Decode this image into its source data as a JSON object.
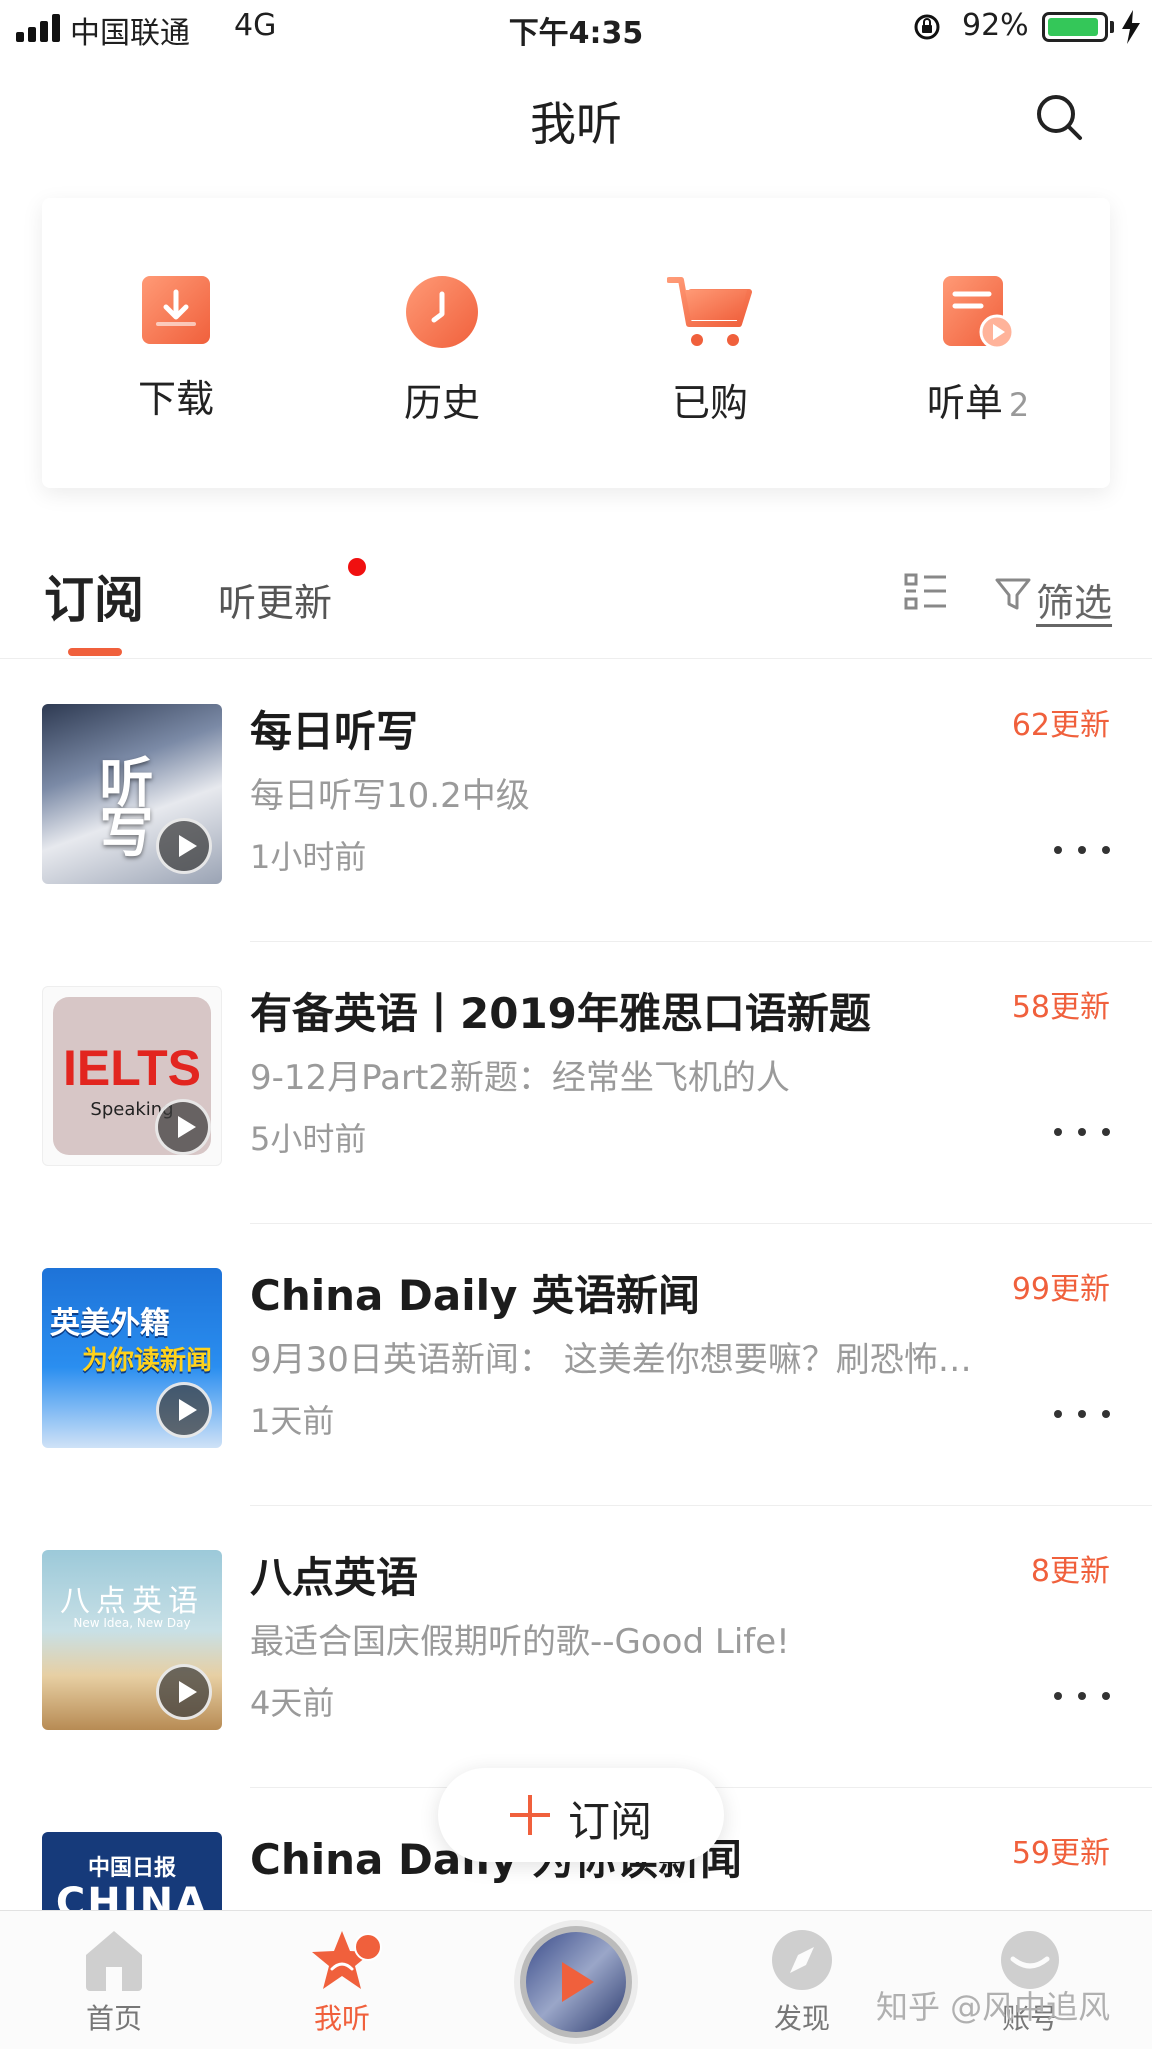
{
  "status_bar": {
    "carrier": "中国联通",
    "network": "4G",
    "time": "下午4:35",
    "battery_percent": "92%",
    "battery_level": 0.92
  },
  "header": {
    "title": "我听",
    "search_icon": "search-icon"
  },
  "quick_actions": [
    {
      "label": "下载",
      "icon": "download-icon",
      "count": ""
    },
    {
      "label": "历史",
      "icon": "clock-icon",
      "count": ""
    },
    {
      "label": "已购",
      "icon": "cart-icon",
      "count": ""
    },
    {
      "label": "听单",
      "icon": "playlist-icon",
      "count": "2"
    }
  ],
  "tabs": {
    "subscribe": "订阅",
    "updates": "听更新",
    "filter": "筛选"
  },
  "subscriptions": [
    {
      "title": "每日听写",
      "subtitle": "每日听写10.2中级",
      "time": "1小时前",
      "badge": "62更新",
      "cover_text": "听写"
    },
    {
      "title": "有备英语丨2019年雅思口语新题",
      "subtitle": "9-12月Part2新题：经常坐飞机的人",
      "time": "5小时前",
      "badge": "58更新",
      "cover_text": "IELTS",
      "cover_sub": "Speaking"
    },
    {
      "title": "China Daily 英语新闻",
      "subtitle": "9月30日英语新闻：  这美差你想要嘛？刷恐怖…",
      "time": "1天前",
      "badge": "99更新",
      "cover_text": "英美外籍",
      "cover_sub": "为你读新闻"
    },
    {
      "title": "八点英语",
      "subtitle": "最适合国庆假期听的歌--Good Life!",
      "time": "4天前",
      "badge": "8更新",
      "cover_text": "八点英语",
      "cover_sub": "New Idea, New Day"
    },
    {
      "title": "China Daily 为你读新闻",
      "subtitle": "",
      "time": "",
      "badge": "59更新",
      "cover_text": "中国日报",
      "cover_sub": "CHINA"
    }
  ],
  "fab": {
    "label": "订阅"
  },
  "bottom_nav": [
    {
      "label": "首页",
      "icon": "home-icon"
    },
    {
      "label": "我听",
      "icon": "star-icon"
    },
    {
      "label": "发现",
      "icon": "compass-icon"
    },
    {
      "label": "账号",
      "icon": "account-icon"
    }
  ],
  "watermark": "知乎 @风中追风",
  "colors": {
    "accent": "#f0603c",
    "badge": "#f0603c",
    "notification_dot": "#f01010"
  }
}
